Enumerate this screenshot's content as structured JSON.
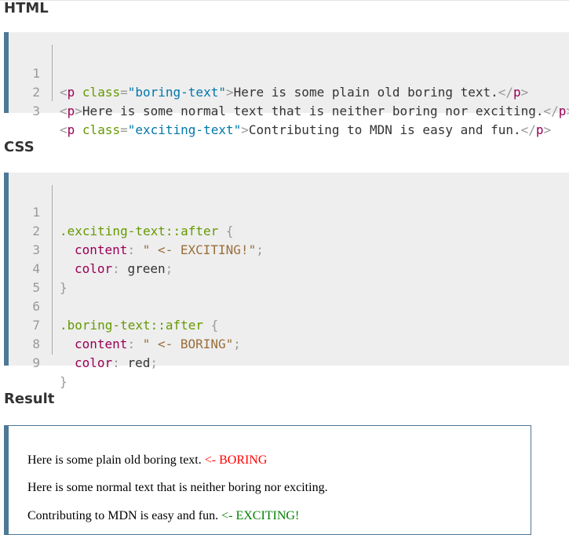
{
  "headings": {
    "html": "HTML",
    "css": "CSS",
    "result": "Result"
  },
  "html_code": {
    "line_numbers": [
      "1",
      "2",
      "3"
    ],
    "line1": {
      "open_lt": "<",
      "tag": "p",
      "sp": " ",
      "attr": "class",
      "eq": "=",
      "value": "\"boring-text\"",
      "open_gt": ">",
      "text": "Here is some plain old boring text.",
      "close": "</",
      "close_tag": "p",
      "close_gt": ">"
    },
    "line2": {
      "open_lt": "<",
      "tag": "p",
      "open_gt": ">",
      "text": "Here is some normal text that is neither boring nor exciting.",
      "close": "</",
      "close_tag": "p",
      "close_gt": ">"
    },
    "line3": {
      "open_lt": "<",
      "tag": "p",
      "sp": " ",
      "attr": "class",
      "eq": "=",
      "value": "\"exciting-text\"",
      "open_gt": ">",
      "text": "Contributing to MDN is easy and fun.",
      "close": "</",
      "close_tag": "p",
      "close_gt": ">"
    }
  },
  "css_code": {
    "line_numbers": [
      "1",
      "2",
      "3",
      "4",
      "5",
      "6",
      "7",
      "8",
      "9"
    ],
    "rule1": {
      "selector": ".exciting-text::after",
      "open_brace": " {",
      "prop1": "content",
      "colon1": ": ",
      "str1": "\" <- EXCITING!\"",
      "semi1": ";",
      "prop2": "color",
      "colon2": ": ",
      "val2": "green",
      "semi2": ";",
      "close_brace": "}"
    },
    "rule2": {
      "selector": ".boring-text::after",
      "open_brace": " {",
      "prop1": "content",
      "colon1": ": ",
      "str1": "\" <- BORING\"",
      "semi1": ";",
      "prop2": "color",
      "colon2": ": ",
      "val2": "red",
      "semi2": ";",
      "close_brace": "}"
    }
  },
  "result": {
    "line1_text": "Here is some plain old boring text.",
    "line1_suffix": " <- BORING",
    "line2_text": "Here is some normal text that is neither boring nor exciting.",
    "line3_text": "Contributing to MDN is easy and fun.",
    "line3_suffix": " <- EXCITING!"
  },
  "colors": {
    "accent_border": "#4d7896",
    "boring": "#ff0000",
    "exciting": "#008000"
  }
}
